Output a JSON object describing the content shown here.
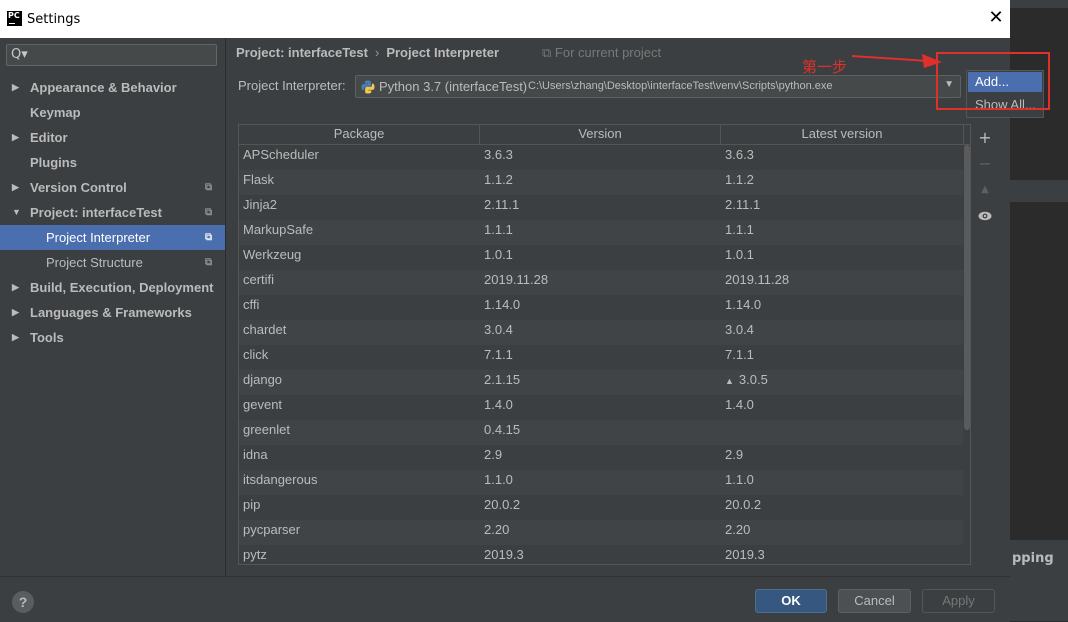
{
  "window": {
    "title": "Settings",
    "close_glyph": "✕",
    "app_logo": "PC"
  },
  "sidebar": {
    "search_placeholder": "Q▾",
    "items": [
      {
        "label": "Appearance & Behavior",
        "arrow": "▶"
      },
      {
        "label": "Keymap",
        "arrow": ""
      },
      {
        "label": "Editor",
        "arrow": "▶"
      },
      {
        "label": "Plugins",
        "arrow": ""
      },
      {
        "label": "Version Control",
        "arrow": "▶"
      },
      {
        "label": "Project: interfaceTest",
        "arrow": "▼"
      },
      {
        "label": "Project Interpreter",
        "arrow": ""
      },
      {
        "label": "Project Structure",
        "arrow": ""
      },
      {
        "label": "Build, Execution, Deployment",
        "arrow": "▶"
      },
      {
        "label": "Languages & Frameworks",
        "arrow": "▶"
      },
      {
        "label": "Tools",
        "arrow": "▶"
      }
    ],
    "copy_glyph": "⧉"
  },
  "breadcrumb": {
    "project": "Project: interfaceTest",
    "separator": "›",
    "page": "Project Interpreter",
    "scope": "⧉ For current project"
  },
  "interpreter": {
    "label": "Project Interpreter:",
    "name": "Python 3.7 (interfaceTest)",
    "path": "C:\\Users\\zhang\\Desktop\\interfaceTest\\venv\\Scripts\\python.exe",
    "dropdown_glyph": "▼"
  },
  "annotation": {
    "text": "第一步",
    "color": "#e0302a"
  },
  "popup": {
    "add": "Add...",
    "show_all": "Show All..."
  },
  "table": {
    "headers": [
      "Package",
      "Version",
      "Latest version"
    ],
    "upgrade_glyph": "▲",
    "rows": [
      {
        "package": "APScheduler",
        "version": "3.6.3",
        "latest": "3.6.3"
      },
      {
        "package": "Flask",
        "version": "1.1.2",
        "latest": "1.1.2"
      },
      {
        "package": "Jinja2",
        "version": "2.11.1",
        "latest": "2.11.1"
      },
      {
        "package": "MarkupSafe",
        "version": "1.1.1",
        "latest": "1.1.1"
      },
      {
        "package": "Werkzeug",
        "version": "1.0.1",
        "latest": "1.0.1"
      },
      {
        "package": "certifi",
        "version": "2019.11.28",
        "latest": "2019.11.28"
      },
      {
        "package": "cffi",
        "version": "1.14.0",
        "latest": "1.14.0"
      },
      {
        "package": "chardet",
        "version": "3.0.4",
        "latest": "3.0.4"
      },
      {
        "package": "click",
        "version": "7.1.1",
        "latest": "7.1.1"
      },
      {
        "package": "django",
        "version": "2.1.15",
        "latest": "3.0.5",
        "upgrade": true
      },
      {
        "package": "gevent",
        "version": "1.4.0",
        "latest": "1.4.0"
      },
      {
        "package": "greenlet",
        "version": "0.4.15",
        "latest": ""
      },
      {
        "package": "idna",
        "version": "2.9",
        "latest": "2.9"
      },
      {
        "package": "itsdangerous",
        "version": "1.1.0",
        "latest": "1.1.0"
      },
      {
        "package": "pip",
        "version": "20.0.2",
        "latest": "20.0.2"
      },
      {
        "package": "pycparser",
        "version": "2.20",
        "latest": "2.20"
      },
      {
        "package": "pytz",
        "version": "2019.3",
        "latest": "2019.3"
      }
    ]
  },
  "tools": {
    "add": "+",
    "remove": "−",
    "upgrade": "▲",
    "show_early": "👁"
  },
  "footer": {
    "help": "?",
    "ok": "OK",
    "cancel": "Cancel",
    "apply": "Apply"
  },
  "background": {
    "right_text": "pping"
  },
  "colors": {
    "selection": "#4b6eaf",
    "dialog_bg": "#3c3f41",
    "ok_button": "#365880"
  }
}
